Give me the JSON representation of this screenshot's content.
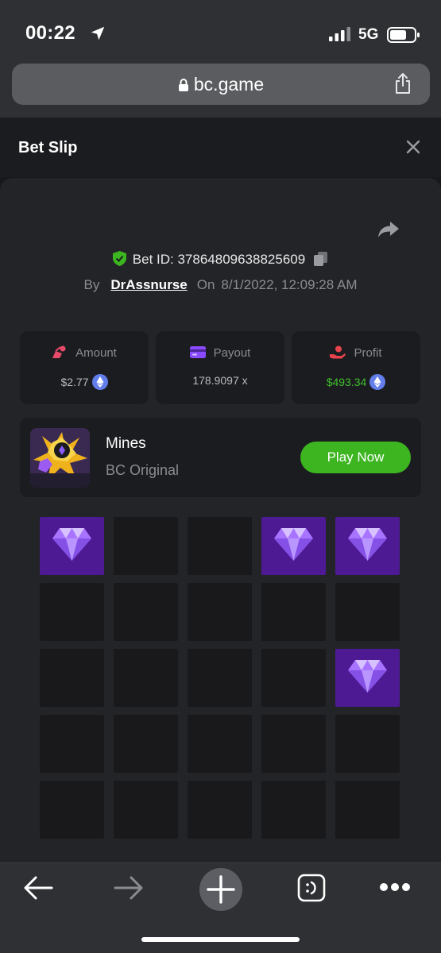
{
  "status_bar": {
    "time": "00:22",
    "network": "5G"
  },
  "browser": {
    "url": "bc.game"
  },
  "bet_slip": {
    "title": "Bet Slip",
    "bet_id_label": "Bet ID: 37864809638825609",
    "by_label": "By",
    "username": "DrAssnurse",
    "on_label": "On",
    "date": "8/1/2022, 12:09:28 AM"
  },
  "stats": {
    "amount": {
      "label": "Amount",
      "value": "$2.77"
    },
    "payout": {
      "label": "Payout",
      "value": "178.9097 x"
    },
    "profit": {
      "label": "Profit",
      "value": "$493.34"
    }
  },
  "game": {
    "name": "Mines",
    "subtitle": "BC Original",
    "thumb_text": "MINE",
    "play_label": "Play Now"
  },
  "board": {
    "revealed_gems": [
      0,
      3,
      4,
      14
    ]
  },
  "colors": {
    "accent_green": "#3cb521",
    "gem_tile": "#4d1a93",
    "profit_green": "#3fc02d"
  },
  "icons": [
    "location-arrow-icon",
    "signal-icon",
    "battery-icon",
    "lock-icon",
    "share-icon",
    "close-icon",
    "share-arrow-icon",
    "shield-check-icon",
    "copy-icon",
    "amount-icon",
    "payout-card-icon",
    "profit-icon",
    "ethereum-icon",
    "gem-icon",
    "back-icon",
    "forward-icon",
    "new-tab-icon",
    "tabs-icon",
    "more-icon"
  ]
}
